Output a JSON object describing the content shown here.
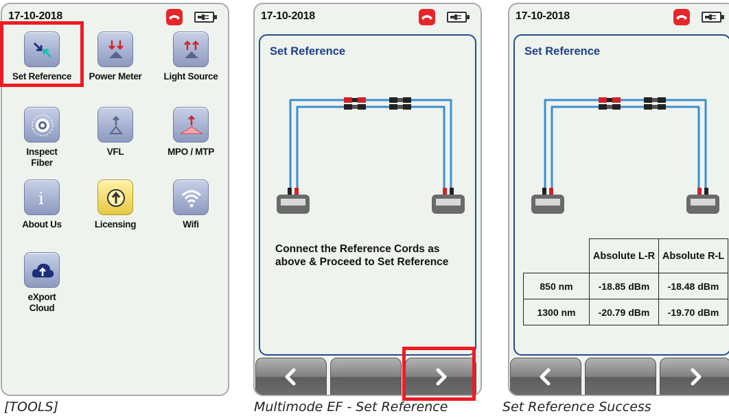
{
  "status": {
    "date": "17-10-2018"
  },
  "tools": [
    {
      "label": "Set Reference",
      "icon": "set-reference-icon"
    },
    {
      "label": "Power Meter",
      "icon": "power-meter-icon"
    },
    {
      "label": "Light Source",
      "icon": "light-source-icon"
    },
    {
      "label": "Inspect Fiber",
      "icon": "inspect-fiber-icon"
    },
    {
      "label": "VFL",
      "icon": "vfl-icon"
    },
    {
      "label": "MPO / MTP",
      "icon": "mpo-mtp-icon"
    },
    {
      "label": "About Us",
      "icon": "info-icon"
    },
    {
      "label": "Licensing",
      "icon": "licensing-icon"
    },
    {
      "label": "Wifi",
      "icon": "wifi-icon"
    },
    {
      "label": "eXport Cloud",
      "icon": "cloud-upload-icon"
    }
  ],
  "set_reference": {
    "title": "Set Reference",
    "message": "Connect the Reference Cords as above & Proceed to Set Reference"
  },
  "result": {
    "title": "Set Reference",
    "columns": [
      "Absolute L-R",
      "Absolute R-L"
    ],
    "rows": [
      {
        "wavelength": "850 nm",
        "lr": "-18.85 dBm",
        "rl": "-18.48 dBm"
      },
      {
        "wavelength": "1300 nm",
        "lr": "-20.79 dBm",
        "rl": "-19.70 dBm"
      }
    ]
  },
  "captions": [
    "[TOOLS]",
    "Multimode EF - Set Reference",
    "Set Reference Success"
  ],
  "colors": {
    "accent_red": "#ee1b24",
    "title_blue": "#1d3f88",
    "fiber_blue": "#3b8fd0"
  }
}
